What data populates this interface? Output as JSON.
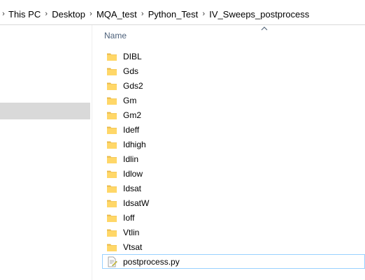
{
  "breadcrumb": {
    "leading_separator": "›",
    "separator": "›",
    "items": [
      {
        "label": "This PC"
      },
      {
        "label": "Desktop"
      },
      {
        "label": "MQA_test"
      },
      {
        "label": "Python_Test"
      },
      {
        "label": "IV_Sweeps_postprocess"
      }
    ]
  },
  "file_list": {
    "column_header": "Name",
    "sort_indicator_icon": "chevron-up-icon",
    "items": [
      {
        "name": "DIBL",
        "type": "folder"
      },
      {
        "name": "Gds",
        "type": "folder"
      },
      {
        "name": "Gds2",
        "type": "folder"
      },
      {
        "name": "Gm",
        "type": "folder"
      },
      {
        "name": "Gm2",
        "type": "folder"
      },
      {
        "name": "Ideff",
        "type": "folder"
      },
      {
        "name": "Idhigh",
        "type": "folder"
      },
      {
        "name": "Idlin",
        "type": "folder"
      },
      {
        "name": "Idlow",
        "type": "folder"
      },
      {
        "name": "Idsat",
        "type": "folder"
      },
      {
        "name": "IdsatW",
        "type": "folder"
      },
      {
        "name": "Ioff",
        "type": "folder"
      },
      {
        "name": "Vtlin",
        "type": "folder"
      },
      {
        "name": "Vtsat",
        "type": "folder"
      },
      {
        "name": "postprocess.py",
        "type": "python-file",
        "selected": true
      }
    ]
  },
  "colors": {
    "header_text": "#4c607a",
    "folder_fill": "#ffd768",
    "folder_tab": "#e8b84a",
    "selection_border": "#99d1ff",
    "nav_selected": "#d9d9d9"
  }
}
